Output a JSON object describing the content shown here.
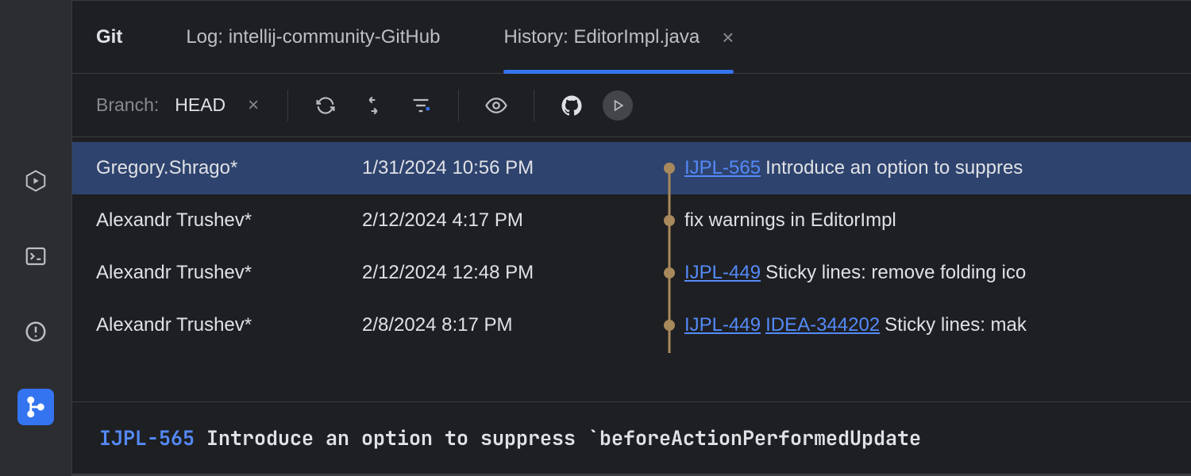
{
  "panel_title": "Git",
  "tabs": [
    {
      "label": "Log: intellij-community-GitHub",
      "active": false,
      "closable": false
    },
    {
      "label": "History: EditorImpl.java",
      "active": true,
      "closable": true
    }
  ],
  "toolbar": {
    "branch_label": "Branch:",
    "branch_value": "HEAD"
  },
  "commits": [
    {
      "author": "Gregory.Shrago*",
      "date": "1/31/2024 10:56 PM",
      "issues": [
        "IJPL-565"
      ],
      "message": "Introduce an option to suppres",
      "selected": true
    },
    {
      "author": "Alexandr Trushev*",
      "date": "2/12/2024 4:17 PM",
      "issues": [],
      "message": "fix warnings in EditorImpl",
      "selected": false
    },
    {
      "author": "Alexandr Trushev*",
      "date": "2/12/2024 12:48 PM",
      "issues": [
        "IJPL-449"
      ],
      "message": "Sticky lines: remove folding ico",
      "selected": false
    },
    {
      "author": "Alexandr Trushev*",
      "date": "2/8/2024 8:17 PM",
      "issues": [
        "IJPL-449",
        "IDEA-344202"
      ],
      "message": "Sticky lines: mak",
      "selected": false
    }
  ],
  "detail": {
    "issue": "IJPL-565",
    "message": "Introduce an option to suppress `beforeActionPerformedUpdate"
  }
}
